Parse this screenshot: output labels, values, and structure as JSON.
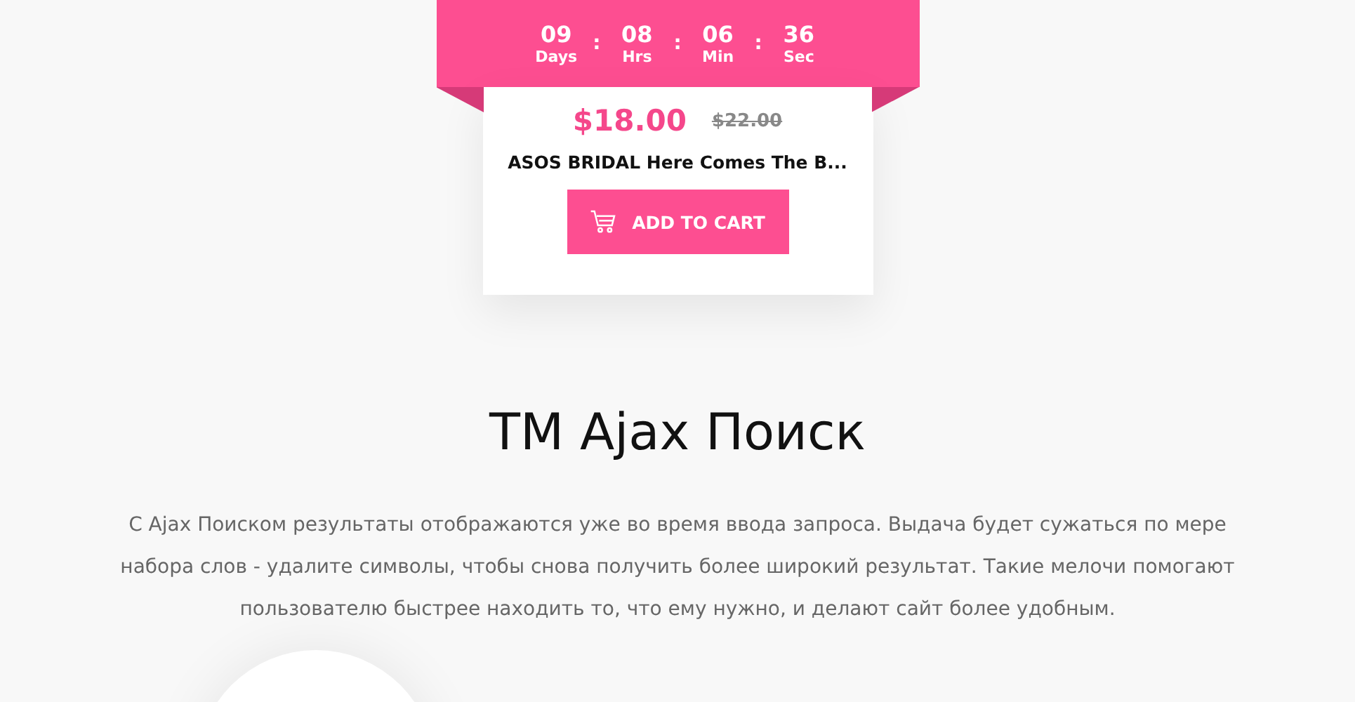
{
  "countdown": [
    {
      "value": "09",
      "unit": "Days"
    },
    {
      "separator": ":",
      "value": "08",
      "unit": "Hrs"
    },
    {
      "separator": ":",
      "value": "06",
      "unit": "Min"
    },
    {
      "separator": ":",
      "value": "36",
      "unit": "Sec"
    }
  ],
  "product": {
    "price": "$18.00",
    "old_price": "$22.00",
    "name": "ASOS BRIDAL Here Comes The B...",
    "button": "ADD TO CART"
  },
  "section": {
    "title": "TM Ajax Поиск",
    "description": "С Ajax Поиском результаты отображаются уже во время ввода запроса. Выдача будет сужаться по мере набора слов - удалите символы, чтобы снова получить более широкий результат. Такие мелочи помогают пользователю быстрее находить то, что ему нужно, и делают сайт более удобным."
  }
}
